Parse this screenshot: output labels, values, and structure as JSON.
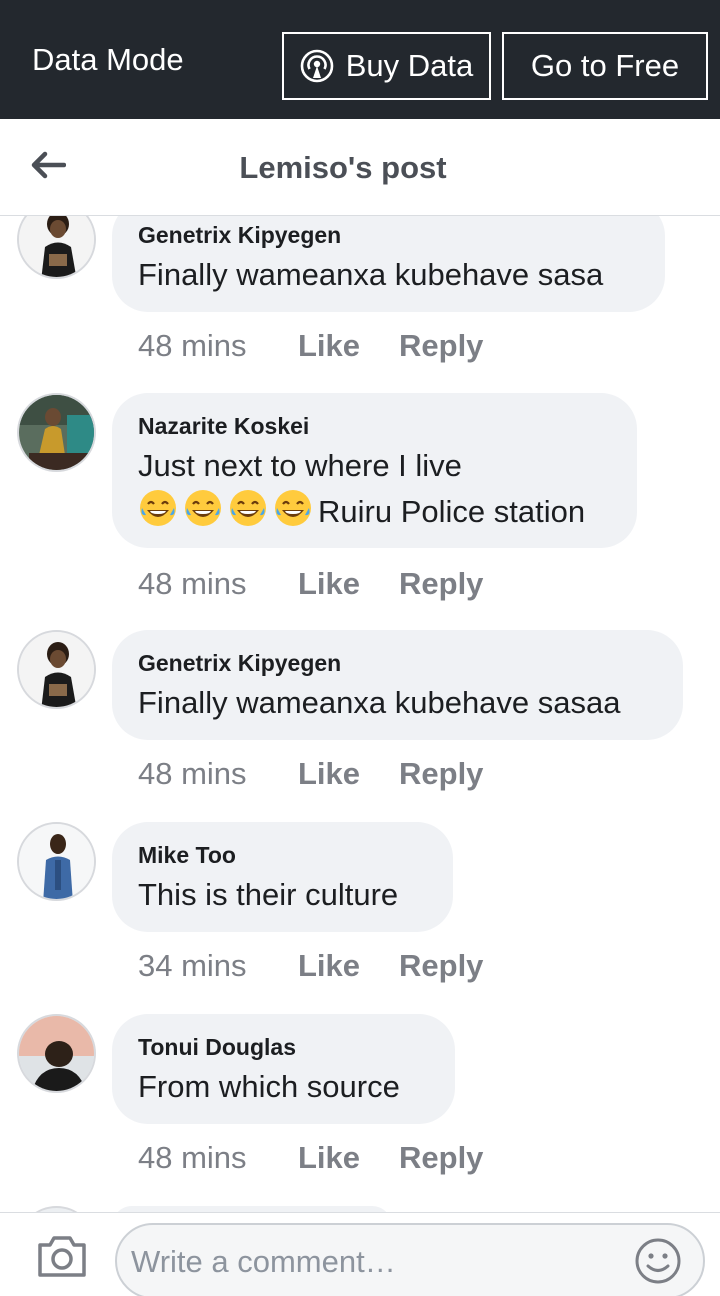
{
  "data_bar": {
    "mode_label": "Data Mode",
    "buy_label": "Buy Data",
    "free_label": "Go to Free",
    "buy_icon": "broadcast-icon"
  },
  "header": {
    "title": "Lemiso's post",
    "back_icon": "back-arrow-icon"
  },
  "comments": [
    {
      "author": "Genetrix Kipyegen",
      "lines": [
        "Finally wameanxa kubehave sasa"
      ],
      "time": "48 mins",
      "like": "Like",
      "reply": "Reply"
    },
    {
      "author": "Nazarite Koskei",
      "lines": [
        "Just next to where I live",
        "Ruiru Police station"
      ],
      "emoji_count": 4,
      "time": "48 mins",
      "like": "Like",
      "reply": "Reply"
    },
    {
      "author": "Genetrix Kipyegen",
      "lines": [
        "Finally wameanxa kubehave sasaa"
      ],
      "time": "48 mins",
      "like": "Like",
      "reply": "Reply"
    },
    {
      "author": "Mike Too",
      "lines": [
        "This is their culture"
      ],
      "time": "34 mins",
      "like": "Like",
      "reply": "Reply"
    },
    {
      "author": "Tonui Douglas",
      "lines": [
        "From which source"
      ],
      "time": "48 mins",
      "like": "Like",
      "reply": "Reply"
    }
  ],
  "composer": {
    "placeholder": "Write a comment…",
    "camera_icon": "camera-icon",
    "emoji_icon": "smiley-icon"
  },
  "colors": {
    "data_bar_bg": "#23282e",
    "bubble_bg": "#f0f2f5",
    "meta_text": "#7c7f86",
    "title_text": "#4b4f56"
  }
}
